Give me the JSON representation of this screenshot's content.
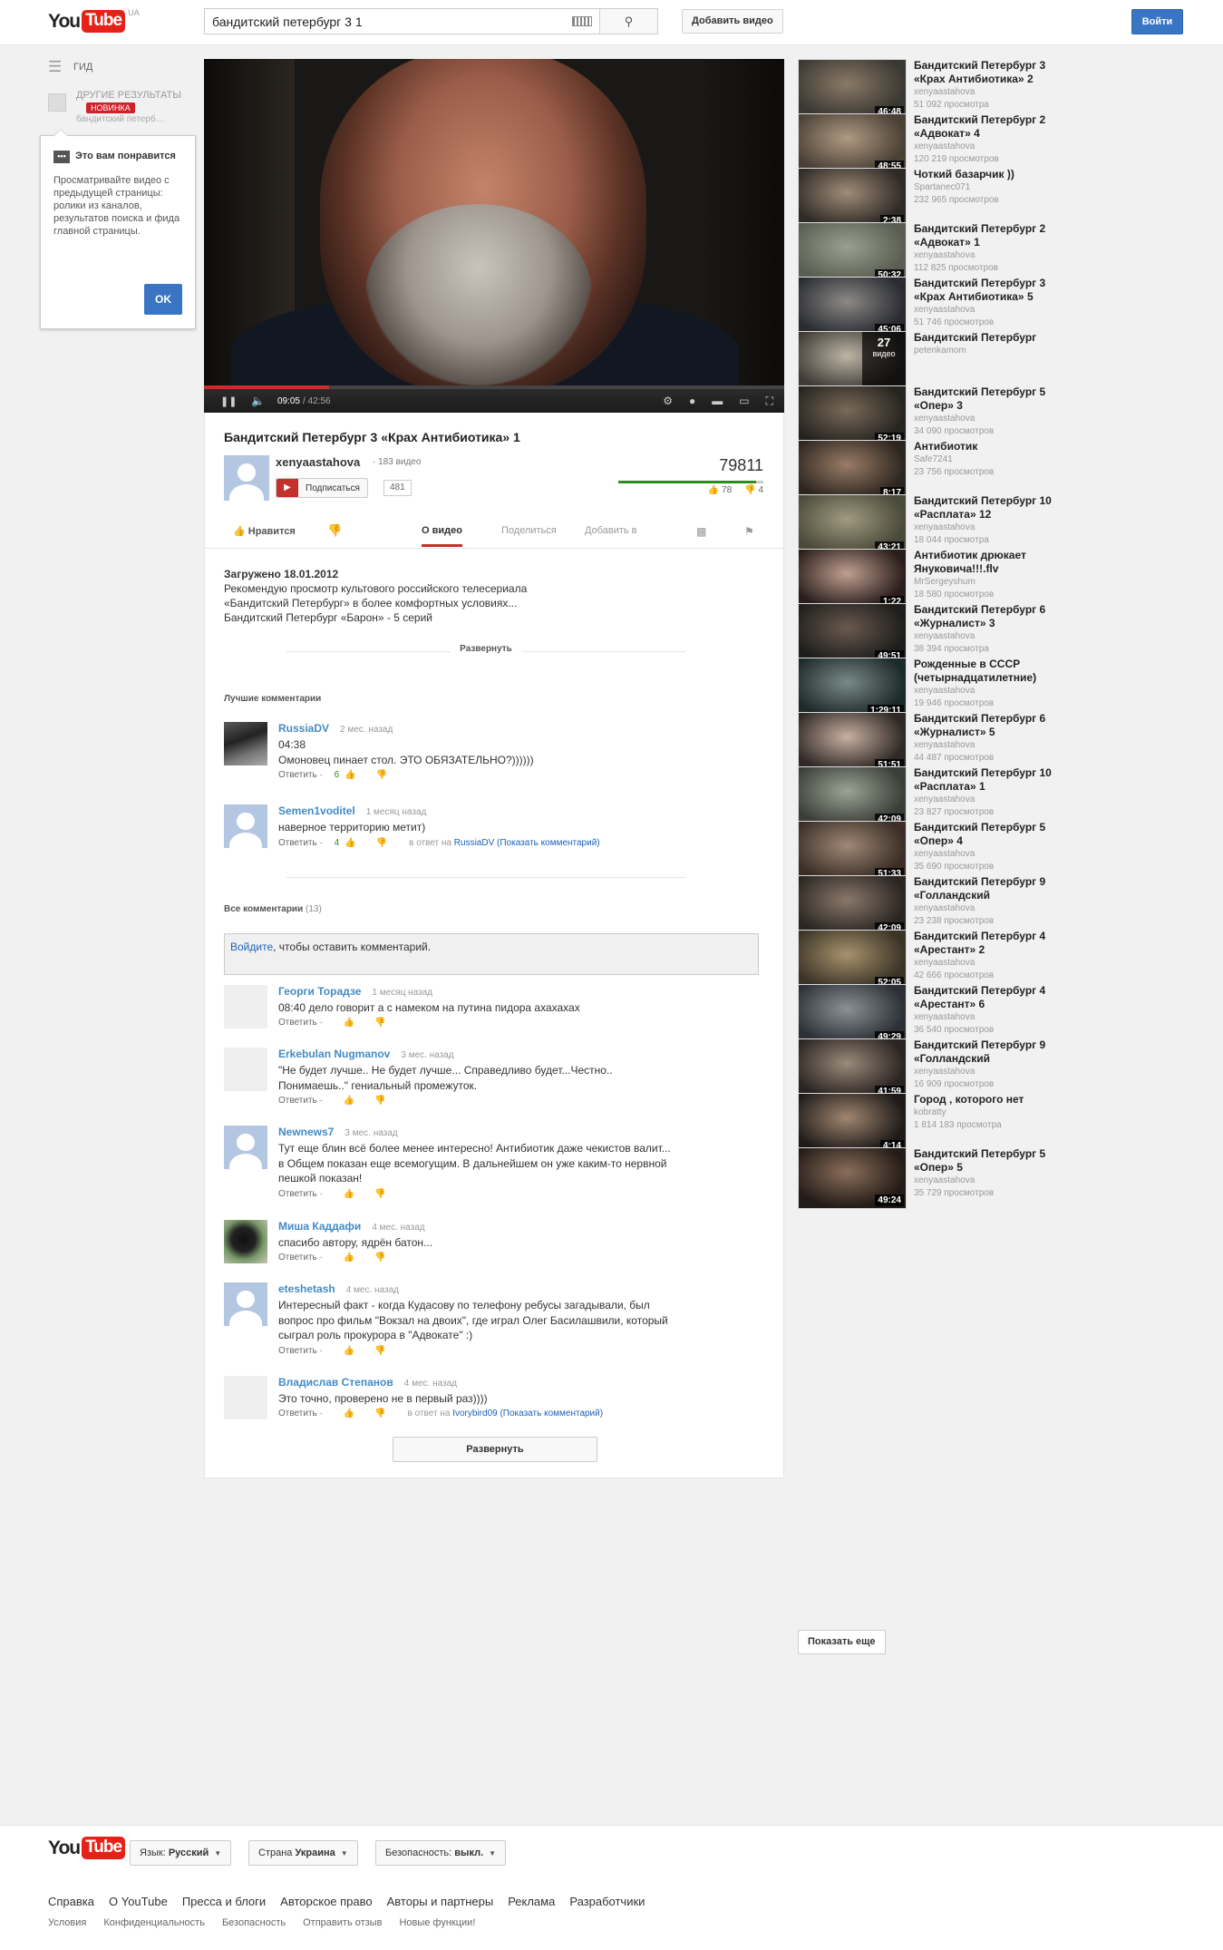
{
  "masthead": {
    "logo_you": "You",
    "logo_tube": "Tube",
    "region": "UA",
    "search_value": "бандитский петербург 3 1",
    "upload_label": "Добавить видео",
    "signin_label": "Войти"
  },
  "guide": {
    "guide_label": "ГИД",
    "other_results_label": "ДРУГИЕ РЕЗУЛЬТАТЫ",
    "new_badge": "НОВИНКА",
    "other_results_sub": "бандитский петерб…"
  },
  "tooltip": {
    "title": "Это вам понравится",
    "body": "Просматривайте видео с предыдущей страницы: ролики из каналов, результатов поиска и фида главной страницы.",
    "ok": "OK"
  },
  "player": {
    "current_time": "09:05",
    "duration": "/ 42:56",
    "progress": 0.215
  },
  "video": {
    "title": "Бандитский Петербург 3 «Крах Антибиотика» 1",
    "channel": "xenyaastahova",
    "video_count": "· 183 видео",
    "subscribe": "Подписаться",
    "subscriber_count": "481",
    "views": "79811",
    "likes": "78",
    "dislikes": "4",
    "like_ratio": 0.951
  },
  "actions": {
    "like": "Нравится",
    "tabs": [
      "О видео",
      "Поделиться",
      "Добавить в"
    ]
  },
  "description": {
    "uploaded": "Загружено 18.01.2012",
    "text_1": "Рекомендую просмотр культового российского телесериала",
    "text_2": "«Бандитский Петербург» в более комфортных условиях...",
    "text_3": "Бандитский Петербург «Барон» - 5 серий",
    "expand": "Развернуть"
  },
  "comments": {
    "top_title": "Лучшие комментарии",
    "all_title": "Все комментарии",
    "all_count": "(13)",
    "signin_link": "Войдите",
    "signin_rest": ", чтобы оставить комментарий.",
    "reply": "Ответить",
    "in_reply": "в ответ на",
    "show_comment": "(Показать комментарий)",
    "more_button": "Развернуть",
    "top": [
      {
        "author": "RussiaDV",
        "time": "2 мес. назад",
        "text": "04:38\nОмоновец пинает стол. ЭТО ОБЯЗАТЕЛЬНО?))))))",
        "score": "6"
      },
      {
        "author": "Semen1voditel",
        "time": "1 месяц назад",
        "text": "наверное территорию метит)",
        "score": "4",
        "reply_to": "RussiaDV"
      }
    ],
    "all": [
      {
        "author": "Георги Торадзе",
        "time": "1 месяц назад",
        "text": "08:40 дело говорит а с намеком на путина пидора ахахахах"
      },
      {
        "author": "Erkebulan Nugmanov",
        "time": "3 мес. назад",
        "text": "\"Не будет лучше.. Не будет лучше... Справедливо будет...Честно.. Понимаешь..\" гениальный промежуток."
      },
      {
        "author": "Newnews7",
        "time": "3 мес. назад",
        "text": "Тут еще блин всё более менее интересно! Антибиотик даже чекистов валит... в Общем показан еще всемогущим. В дальнейшем он уже каким-то нервной пешкой показан!"
      },
      {
        "author": "Миша Каддафи",
        "time": "4 мес. назад",
        "text": "спасибо автору, ядрён батон..."
      },
      {
        "author": "eteshetash",
        "time": "4 мес. назад",
        "text": "Интересный факт - когда Кудасову по телефону ребусы загадывали, был вопрос про фильм \"Вокзал на двоих\", где играл Олег Басилашвили, который сыграл роль прокурора в \"Адвокате\" :)"
      },
      {
        "author": "Владислав Степанов",
        "time": "4 мес. назад",
        "text": "Это точно, проверено не в первый раз))))",
        "reply_to": "Ivorybird09"
      }
    ]
  },
  "related": [
    {
      "title": "Бандитский Петербург 3 «Крах Антибиотика» 2",
      "user": "xenyaastahova",
      "views": "51 092 просмотра",
      "duration": "46:48"
    },
    {
      "title": "Бандитский Петербург 2 «Адвокат» 4",
      "user": "xenyaastahova",
      "views": "120 219 просмотров",
      "duration": "48:55"
    },
    {
      "title": "Чоткий базарчик ))",
      "user": "Spartanec071",
      "views": "232 965 просмотров",
      "duration": "2:38"
    },
    {
      "title": "Бандитский Петербург 2 «Адвокат» 1",
      "user": "xenyaastahova",
      "views": "112 825 просмотров",
      "duration": "50:32"
    },
    {
      "title": "Бандитский Петербург 3 «Крах Антибиотика» 5",
      "user": "xenyaastahova",
      "views": "51 746 просмотров",
      "duration": "45:06"
    },
    {
      "title": "Бандитский Петербург",
      "user": "petenkamom",
      "views": "",
      "duration": "",
      "playlist_count": "27",
      "playlist_label": "видео"
    },
    {
      "title": "Бандитский Петербург 5 «Опер» 3",
      "user": "xenyaastahova",
      "views": "34 090 просмотров",
      "duration": "52:19"
    },
    {
      "title": "Антибиотик",
      "user": "Safe7241",
      "views": "23 756 просмотров",
      "duration": "8:17"
    },
    {
      "title": "Бандитский Петербург 10 «Расплата» 12",
      "user": "xenyaastahova",
      "views": "18 044 просмотра",
      "duration": "43:21"
    },
    {
      "title": "Антибиотик дрюкает Януковича!!!.flv",
      "user": "MrSergeyshum",
      "views": "18 580 просмотров",
      "duration": "1:22"
    },
    {
      "title": "Бандитский Петербург 6 «Журналист» 3",
      "user": "xenyaastahova",
      "views": "38 394 просмотра",
      "duration": "49:51"
    },
    {
      "title": "Рожденные в СССР (четырнадцатилетние)",
      "user": "xenyaastahova",
      "views": "19 946 просмотров",
      "duration": "1:29:11"
    },
    {
      "title": "Бандитский Петербург 6 «Журналист» 5",
      "user": "xenyaastahova",
      "views": "44 487 просмотров",
      "duration": "51:51"
    },
    {
      "title": "Бандитский Петербург 10 «Расплата» 1",
      "user": "xenyaastahova",
      "views": "23 827 просмотров",
      "duration": "42:09"
    },
    {
      "title": "Бандитский Петербург 5 «Опер» 4",
      "user": "xenyaastahova",
      "views": "35 690 просмотров",
      "duration": "51:33"
    },
    {
      "title": "Бандитский Петербург 9 «Голландский",
      "user": "xenyaastahova",
      "views": "23 238 просмотров",
      "duration": "42:09"
    },
    {
      "title": "Бандитский Петербург 4 «Арестант» 2",
      "user": "xenyaastahova",
      "views": "42 666 просмотров",
      "duration": "52:05"
    },
    {
      "title": "Бандитский Петербург 4 «Арестант» 6",
      "user": "xenyaastahova",
      "views": "36 540 просмотров",
      "duration": "49:29"
    },
    {
      "title": "Бандитский Петербург 9 «Голландский",
      "user": "xenyaastahova",
      "views": "16 909 просмотров",
      "duration": "41:59"
    },
    {
      "title": "Город , которого нет",
      "user": "kobratty",
      "views": "1 814 183 просмотра",
      "duration": "4:14"
    },
    {
      "title": "Бандитский Петербург 5 «Опер» 5",
      "user": "xenyaastahova",
      "views": "35 729 просмотров",
      "duration": "49:24"
    }
  ],
  "show_more": "Показать еще",
  "footer": {
    "language_label": "Язык:",
    "language_value": "Русский",
    "country_label": "Страна",
    "country_value": "Украина",
    "safety_label": "Безопасность:",
    "safety_value": "выкл.",
    "links": [
      "Справка",
      "О YouTube",
      "Пресса и блоги",
      "Авторское право",
      "Авторы и партнеры",
      "Реклама",
      "Разработчики"
    ],
    "links2": [
      "Условия",
      "Конфиденциальность",
      "Безопасность",
      "Отправить отзыв",
      "Новые функции!"
    ]
  },
  "colors": {
    "brand_red": "#e62117",
    "accent_blue": "#3a75c4",
    "link_blue": "#438bc5"
  }
}
